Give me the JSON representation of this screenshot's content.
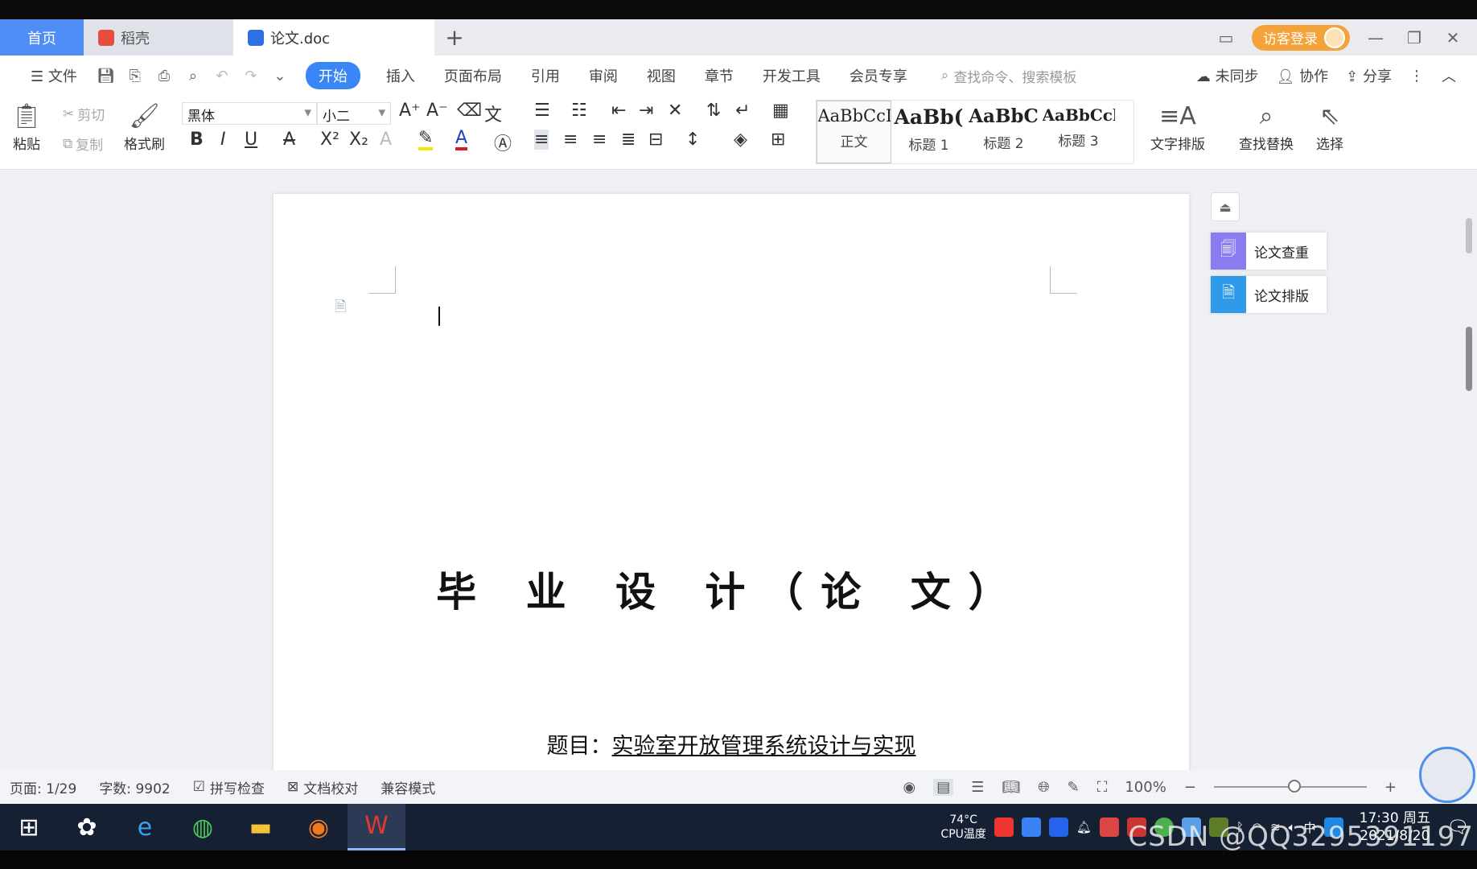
{
  "tabs": {
    "home": "首页",
    "daoke": "稻壳",
    "doc": "论文.doc",
    "add": "+"
  },
  "topbar": {
    "login": "访客登录"
  },
  "menu": {
    "file": "文件",
    "items": [
      "开始",
      "插入",
      "页面布局",
      "引用",
      "审阅",
      "视图",
      "章节",
      "开发工具",
      "会员专享"
    ],
    "search_placeholder": "查找命令、搜索模板",
    "sync": "未同步",
    "collab": "协作",
    "share": "分享"
  },
  "ribbon": {
    "paste": "粘贴",
    "cut": "剪切",
    "copy": "复制",
    "format_painter": "格式刷",
    "font_name": "黑体",
    "font_size": "小二",
    "styles": [
      {
        "sample": "AaBbCcI",
        "name": "正文"
      },
      {
        "sample": "AaBb(",
        "name": "标题 1"
      },
      {
        "sample": "AaBbC",
        "name": "标题 2"
      },
      {
        "sample": "AaBbCcl",
        "name": "标题 3"
      }
    ],
    "text_layout": "文字排版",
    "find_replace": "查找替换",
    "select": "选择"
  },
  "document": {
    "title": "毕 业 设 计（论 文）",
    "topic_label": "题目：",
    "topic_value": "实验室开放管理系统设计与实现"
  },
  "side_panel": {
    "check": "论文查重",
    "layout": "论文排版"
  },
  "status": {
    "page": "页面: 1/29",
    "words": "字数: 9902",
    "spell": "拼写检查",
    "proof": "文档校对",
    "compat": "兼容模式",
    "zoom": "100%"
  },
  "taskbar": {
    "cpu_temp": "74°C",
    "cpu_label": "CPU温度",
    "ime": "中",
    "time": "17:30 周五",
    "date": "2021/8/20"
  },
  "watermark": "CSDN @QQ3295391197",
  "colors": {
    "accent": "#3a86f5",
    "home_tab": "#4f8ef7",
    "login": "#f4a23a",
    "taskbar": "#162033"
  }
}
